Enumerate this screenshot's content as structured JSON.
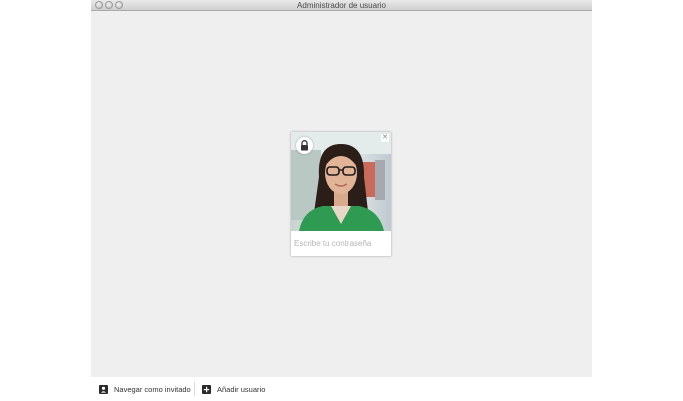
{
  "window": {
    "title": "Administrador de usuario"
  },
  "user_card": {
    "password_placeholder": "Escribe tu contraseña",
    "lock_icon": "lock-icon",
    "close_icon": "close-icon"
  },
  "bottom_bar": {
    "guest_label": "Navegar como invitado",
    "add_user_label": "Añadir usuario",
    "guest_icon": "person-icon",
    "add_icon": "plus-icon"
  },
  "colors": {
    "window_background": "#efefef",
    "bottom_bar_background": "#ffffff",
    "icon_color": "#2a2a2a"
  }
}
